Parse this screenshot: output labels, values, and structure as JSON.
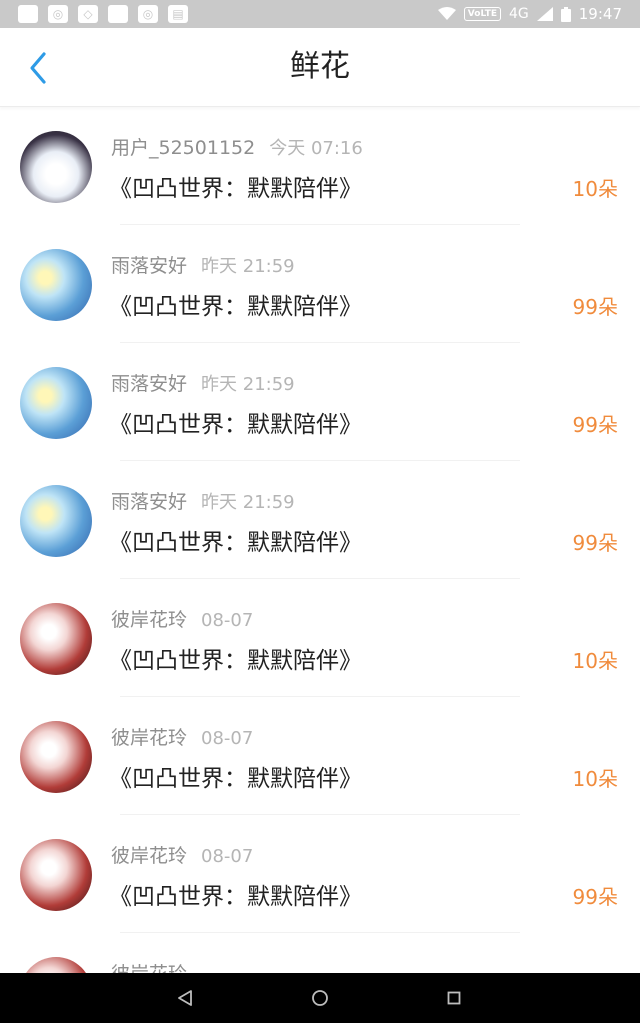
{
  "status_bar": {
    "network_badge": "VoLTE",
    "network_type": "4G",
    "time": "19:47",
    "left_icons": [
      "square-notification-icon",
      "browser-icon",
      "diamond-app-icon",
      "square-notification-icon",
      "compass-icon",
      "shield-icon"
    ]
  },
  "header": {
    "title": "鲜花",
    "back_icon": "chevron-left-icon",
    "accent_color": "#2e9be6"
  },
  "items": [
    {
      "user": "用户_52501152",
      "time": "今天 07:16",
      "book": "《凹凸世界：默默陪伴》",
      "amount": "10朵",
      "avatar_style": "girl"
    },
    {
      "user": "雨落安好",
      "time": "昨天 21:59",
      "book": "《凹凸世界：默默陪伴》",
      "amount": "99朵",
      "avatar_style": "blue"
    },
    {
      "user": "雨落安好",
      "time": "昨天 21:59",
      "book": "《凹凸世界：默默陪伴》",
      "amount": "99朵",
      "avatar_style": "blue"
    },
    {
      "user": "雨落安好",
      "time": "昨天 21:59",
      "book": "《凹凸世界：默默陪伴》",
      "amount": "99朵",
      "avatar_style": "blue"
    },
    {
      "user": "彼岸花玲",
      "time": "08-07",
      "book": "《凹凸世界：默默陪伴》",
      "amount": "10朵",
      "avatar_style": "dark"
    },
    {
      "user": "彼岸花玲",
      "time": "08-07",
      "book": "《凹凸世界：默默陪伴》",
      "amount": "10朵",
      "avatar_style": "dark"
    },
    {
      "user": "彼岸花玲",
      "time": "08-07",
      "book": "《凹凸世界：默默陪伴》",
      "amount": "99朵",
      "avatar_style": "dark"
    },
    {
      "user": "彼岸花玲",
      "time": "",
      "book": "",
      "amount": "",
      "avatar_style": "dark"
    }
  ],
  "amount_color": "#f08b3c",
  "nav_bar": {
    "icons": [
      "back-triangle-icon",
      "home-circle-icon",
      "recents-square-icon"
    ]
  }
}
